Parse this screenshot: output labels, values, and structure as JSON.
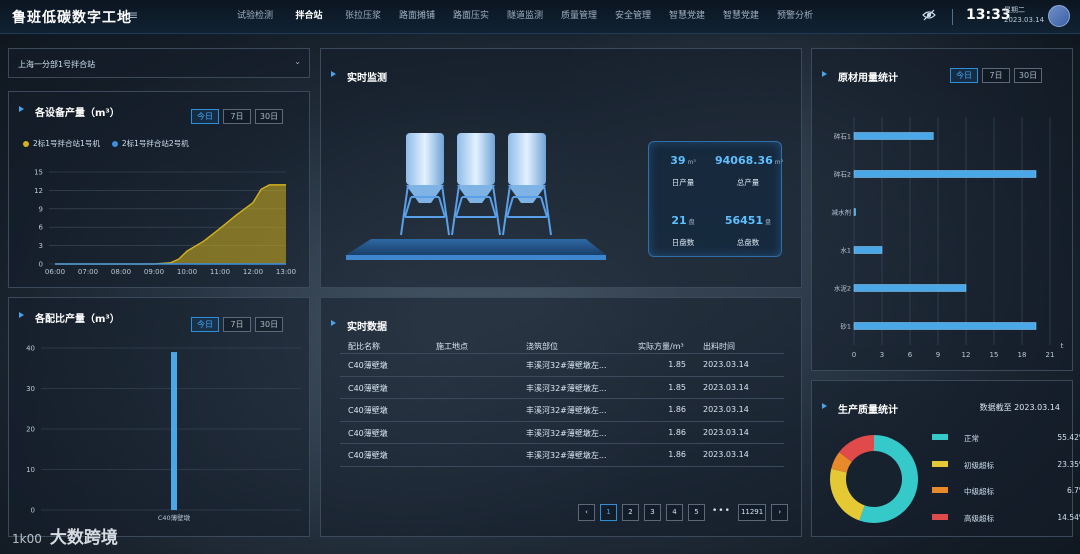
{
  "header": {
    "title": "鲁班低碳数字工地",
    "nav": [
      "试验检测",
      "拌合站",
      "张拉压浆",
      "路面摊铺",
      "路面压实",
      "隧道监测",
      "质量管理",
      "安全管理",
      "智慧党建",
      "智慧党建",
      "预警分析"
    ],
    "active_nav": 1,
    "time": "13:33",
    "weekday": "星期二",
    "date": "2023.03.14"
  },
  "station_select": {
    "value": "上海一分部1号拌合站"
  },
  "device_output": {
    "title": "各设备产量（m³）",
    "ranges": [
      "今日",
      "7日",
      "30日"
    ],
    "active_range": 0,
    "legend": [
      {
        "name": "2标1号拌合站1号机",
        "color": "#d4b21e"
      },
      {
        "name": "2标1号拌合站2号机",
        "color": "#3d8fe0"
      }
    ]
  },
  "ratio_output": {
    "title": "各配比产量（m³）",
    "ranges": [
      "今日",
      "7日",
      "30日"
    ],
    "active_range": 0
  },
  "monitor": {
    "title": "实时监测",
    "stats": [
      {
        "value": "39",
        "unit": "m³",
        "label": "日产量"
      },
      {
        "value": "94068.36",
        "unit": "m³",
        "label": "总产量"
      },
      {
        "value": "21",
        "unit": "盘",
        "label": "日盘数"
      },
      {
        "value": "56451",
        "unit": "盘",
        "label": "总盘数"
      }
    ]
  },
  "realtime": {
    "title": "实时数据",
    "columns": [
      "配比名称",
      "施工地点",
      "浇筑部位",
      "实际方量/m³",
      "出料时间"
    ],
    "rows": [
      [
        "C40薄壁墩",
        "",
        "丰溪河32#薄壁墩左...",
        "1.85",
        "2023.03.14"
      ],
      [
        "C40薄壁墩",
        "",
        "丰溪河32#薄壁墩左...",
        "1.85",
        "2023.03.14"
      ],
      [
        "C40薄壁墩",
        "",
        "丰溪河32#薄壁墩左...",
        "1.86",
        "2023.03.14"
      ],
      [
        "C40薄壁墩",
        "",
        "丰溪河32#薄壁墩左...",
        "1.86",
        "2023.03.14"
      ],
      [
        "C40薄壁墩",
        "",
        "丰溪河32#薄壁墩左...",
        "1.86",
        "2023.03.14"
      ]
    ],
    "pager": {
      "prev": "‹",
      "pages": [
        "1",
        "2",
        "3",
        "4",
        "5"
      ],
      "current": "1",
      "ellipsis": "•••",
      "last": "11291",
      "next": "›"
    }
  },
  "material": {
    "title": "原材用量统计",
    "ranges": [
      "今日",
      "7日",
      "30日"
    ],
    "active_range": 0
  },
  "quality": {
    "title": "生产质量统计",
    "as_of": "数据截至 2023.03.14",
    "items": [
      {
        "name": "正常",
        "pct": "55.42%",
        "color": "#35c9c9"
      },
      {
        "name": "初级超标",
        "pct": "23.35%",
        "color": "#e4c935"
      },
      {
        "name": "中级超标",
        "pct": "6.7%",
        "color": "#e8892a"
      },
      {
        "name": "高级超标",
        "pct": "14.54%",
        "color": "#e04a4a"
      }
    ]
  },
  "watermark": {
    "mark": "1k00",
    "text": "大数跨境"
  },
  "chart_data": [
    {
      "type": "area",
      "x": [
        "06:00",
        "07:00",
        "08:00",
        "09:00",
        "10:00",
        "11:00",
        "12:00",
        "13:00"
      ],
      "ylim": [
        0,
        15
      ],
      "yticks": [
        0,
        3,
        6,
        9,
        12,
        15
      ],
      "series": [
        {
          "name": "2标1号拌合站1号机",
          "color": "#d4b21e",
          "points": [
            [
              0,
              0
            ],
            [
              1,
              0
            ],
            [
              2,
              0
            ],
            [
              3,
              0
            ],
            [
              3.5,
              0.2
            ],
            [
              3.75,
              0.8
            ],
            [
              4,
              2.1
            ],
            [
              4.5,
              3.7
            ],
            [
              5,
              5.8
            ],
            [
              5.5,
              8
            ],
            [
              6,
              10
            ],
            [
              6.25,
              12.2
            ],
            [
              6.5,
              12.9
            ],
            [
              7,
              12.9
            ]
          ]
        },
        {
          "name": "2标1号拌合站2号机",
          "color": "#3d8fe0",
          "points": [
            [
              0,
              0
            ],
            [
              7,
              0
            ]
          ]
        }
      ]
    },
    {
      "type": "bar",
      "categories": [
        "C40薄壁墩"
      ],
      "values": [
        39
      ],
      "ylim": [
        0,
        40
      ],
      "yticks": [
        0,
        10,
        20,
        30,
        40
      ]
    },
    {
      "type": "bar",
      "orientation": "horizontal",
      "categories": [
        "碎石1",
        "碎石2",
        "减水剂",
        "水1",
        "水泥2",
        "砂1"
      ],
      "values": [
        8.5,
        19.5,
        0.1,
        3,
        12,
        19.5
      ],
      "xlim": [
        0,
        21
      ],
      "xticks": [
        0,
        3,
        6,
        9,
        12,
        15,
        18,
        21
      ],
      "xlabel": "t"
    },
    {
      "type": "pie",
      "categories": [
        "正常",
        "初级超标",
        "中级超标",
        "高级超标"
      ],
      "values": [
        55.42,
        23.35,
        6.7,
        14.54
      ]
    }
  ]
}
